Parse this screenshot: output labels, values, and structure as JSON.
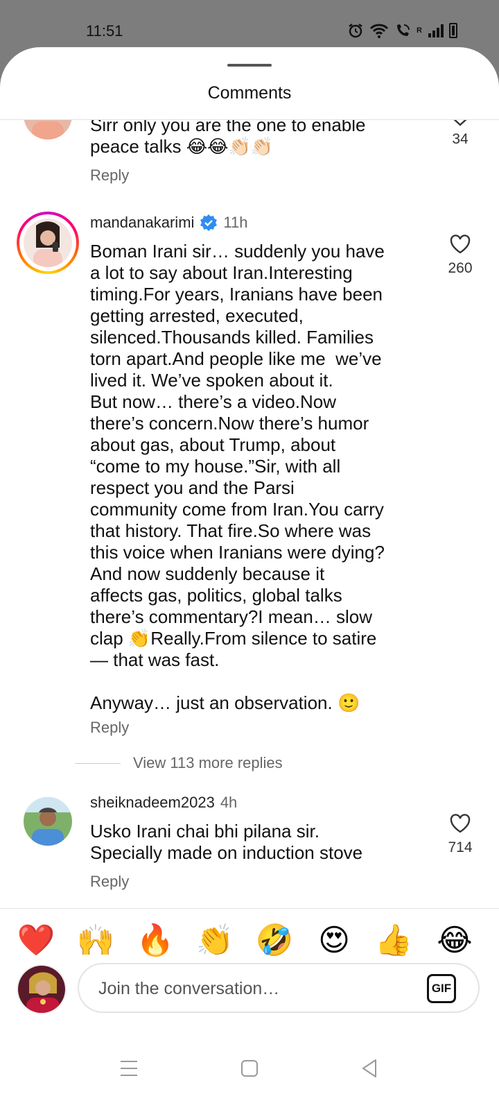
{
  "status_bar": {
    "time": "11:51",
    "signal_label": "R"
  },
  "sheet": {
    "title": "Comments"
  },
  "comments": [
    {
      "text": "Sirr only you are the one to enable\npeace talks 😂😂👏🏻👏🏻",
      "reply": "Reply",
      "likes": "34"
    },
    {
      "username": "mandanakarimi",
      "time": "11h",
      "text": "Boman Irani sir… suddenly you have\na lot to say about Iran.Interesting\ntiming.For years, Iranians have been\ngetting arrested, executed,\nsilenced.Thousands killed. Families\ntorn apart.And people like me  we’ve\nlived it. We’ve spoken about it.\nBut now… there’s a video.Now\nthere’s concern.Now there’s humor\nabout gas, about Trump, about\n“come to my house.”Sir, with all\nrespect you and the Parsi\ncommunity come from Iran.You carry\nthat history. That fire.So where was\nthis voice when Iranians were dying?\nAnd now suddenly because it\naffects gas, politics, global talks\nthere’s commentary?I mean… slow\nclap 👏Really.From silence to satire\n— that was fast.\n\nAnyway… just an observation. 🙂",
      "reply": "Reply",
      "likes": "260",
      "more_replies": "View 113 more replies"
    },
    {
      "username": "sheiknadeem2023",
      "time": "4h",
      "text": "Usko Irani chai bhi pilana sir.\nSpecially made on induction stove",
      "reply": "Reply",
      "likes": "714"
    }
  ],
  "emoji_tray": [
    "❤️",
    "🙌",
    "🔥",
    "👏",
    "🤣",
    "😍",
    "👍",
    "😂"
  ],
  "composer": {
    "placeholder": "Join the conversation…",
    "gif_label": "GIF"
  },
  "colors": {
    "verified": "#2f8cf0",
    "story_ring_start": "#d300c5",
    "story_ring_end": "#ffd600"
  },
  "icons": [
    "alarm-icon",
    "wifi-icon",
    "wifi-call-icon",
    "signal-icon",
    "battery-icon",
    "heart-icon",
    "verified-badge-icon",
    "menu-nav-icon",
    "home-nav-icon",
    "back-nav-icon"
  ]
}
